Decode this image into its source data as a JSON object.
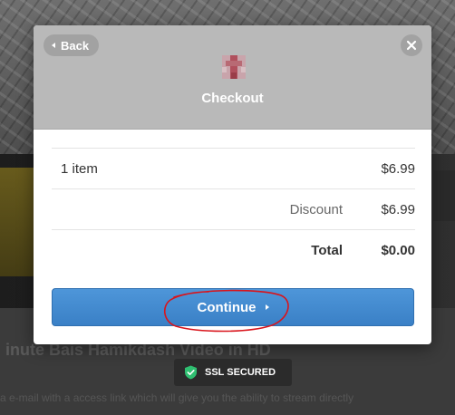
{
  "background": {
    "heading": "inute Bais Hamikdash Video in HD",
    "text": "a e-mail with a access link which will give you the ability to stream directly"
  },
  "modal": {
    "back_label": "Back",
    "title": "Checkout",
    "line_items": {
      "items_label": "1 item",
      "items_amount": "$6.99",
      "discount_label": "Discount",
      "discount_amount": "$6.99",
      "total_label": "Total",
      "total_amount": "$0.00"
    },
    "continue_label": "Continue"
  },
  "ssl_badge": {
    "label": "SSL SECURED",
    "icon": "shield-check-icon"
  },
  "colors": {
    "header": "#b9b9b9",
    "continue": "#4689cf",
    "annotation": "#d9141b",
    "shield": "#2fbf71"
  }
}
